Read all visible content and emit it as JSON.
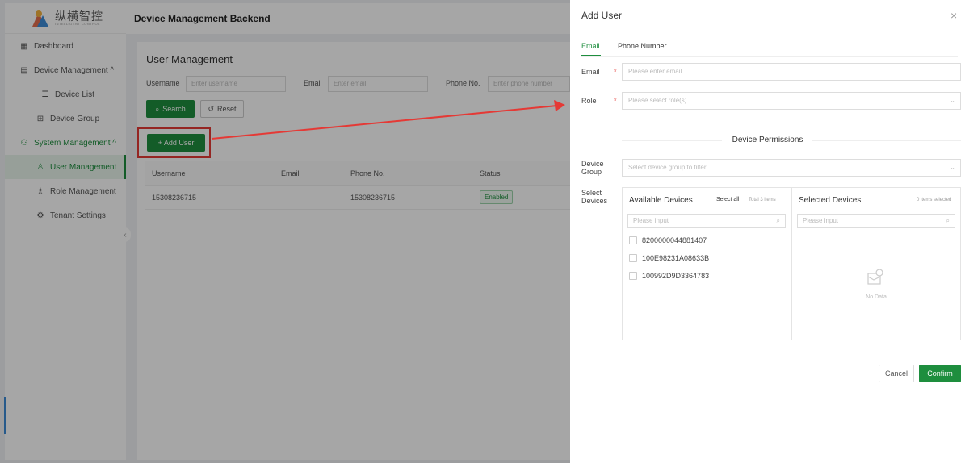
{
  "brand": {
    "name_cn": "纵横智控",
    "name_en": "INTELLIGENT CONTROL"
  },
  "header": {
    "title": "Device Management Backend"
  },
  "sidebar": {
    "items": [
      {
        "label": "Dashboard",
        "icon": "dashboard-icon"
      },
      {
        "label": "Device Management ^",
        "icon": "device-icon"
      },
      {
        "label": "Device List",
        "icon": "list-icon"
      },
      {
        "label": "Device Group",
        "icon": "group-icon"
      },
      {
        "label": "System Management ^",
        "icon": "system-icon"
      },
      {
        "label": "User Management",
        "icon": "user-icon"
      },
      {
        "label": "Role Management",
        "icon": "role-icon"
      },
      {
        "label": "Tenant Settings",
        "icon": "settings-icon"
      }
    ],
    "collapse": "‹"
  },
  "main": {
    "title": "User Management",
    "filters": {
      "username_label": "Username",
      "username_placeholder": "Enter username",
      "email_label": "Email",
      "email_placeholder": "Enter email",
      "phone_label": "Phone No.",
      "phone_placeholder": "Enter phone number"
    },
    "search_label": "Search",
    "reset_label": "Reset",
    "add_user_label": "+ Add User",
    "table": {
      "columns": [
        "Username",
        "Email",
        "Phone No.",
        "Status"
      ],
      "rows": [
        {
          "username": "15308236715",
          "email": "",
          "phone": "15308236715",
          "status": "Enabled"
        }
      ]
    }
  },
  "drawer": {
    "title": "Add User",
    "close": "×",
    "tabs": [
      "Email",
      "Phone Number"
    ],
    "email_label": "Email",
    "email_placeholder": "Please enter email",
    "role_label": "Role",
    "role_placeholder": "Please select role(s)",
    "section_title": "Device Permissions",
    "group_label": "Device Group",
    "group_placeholder": "Select device group to filter",
    "select_label": "Select Devices",
    "available": {
      "title": "Available Devices",
      "select_all": "Select all",
      "total": "Total 3 items",
      "search_placeholder": "Please input",
      "devices": [
        "8200000044881407",
        "100E98231A08633B",
        "100992D9D3364783"
      ]
    },
    "selected": {
      "title": "Selected Devices",
      "count": "0 items selected",
      "search_placeholder": "Please input",
      "empty": "No Data"
    },
    "cancel_label": "Cancel",
    "confirm_label": "Confirm"
  },
  "colors": {
    "accent": "#1e8e3e",
    "highlight": "#e53935"
  }
}
